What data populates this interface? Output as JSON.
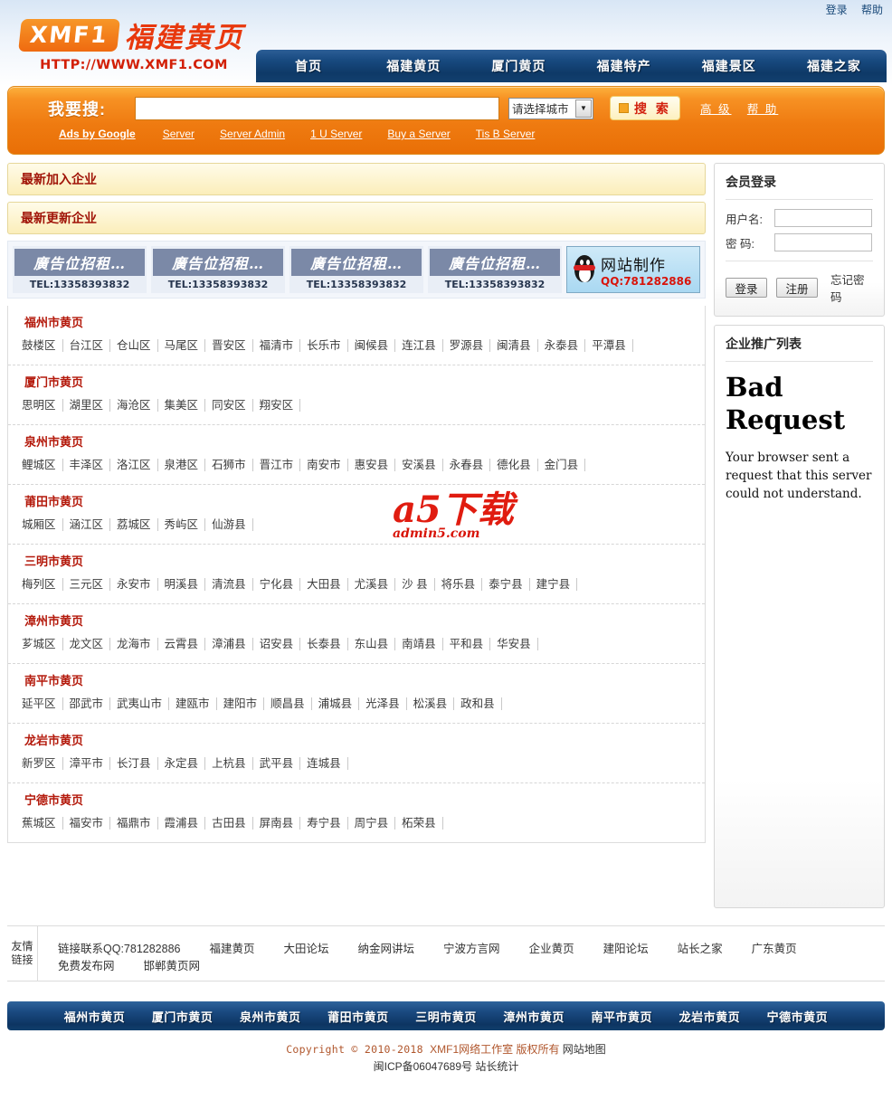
{
  "top": {
    "links": [
      {
        "label": "登录"
      },
      {
        "label": "帮助"
      }
    ]
  },
  "logo": {
    "mark": "XMF1",
    "cn": "福建黄页",
    "url": "HTTP://WWW.XMF1.COM"
  },
  "mainnav": [
    {
      "label": "首页"
    },
    {
      "label": "福建黄页"
    },
    {
      "label": "厦门黄页"
    },
    {
      "label": "福建特产"
    },
    {
      "label": "福建景区"
    },
    {
      "label": "福建之家"
    }
  ],
  "search": {
    "label": "我要搜:",
    "input_value": "",
    "input_placeholder": "",
    "city_selected": "请选择城市",
    "button": "搜 索",
    "advanced": "高 级",
    "help": "帮 助",
    "ads_label": "Ads by Google",
    "ads_links": [
      {
        "label": "Server"
      },
      {
        "label": "Server Admin"
      },
      {
        "label": "1 U Server"
      },
      {
        "label": "Buy a Server"
      },
      {
        "label": "Tis B Server"
      }
    ]
  },
  "panels": {
    "newest_joined": "最新加入企业",
    "newest_updated": "最新更新企业"
  },
  "ads": {
    "banner_text": "廣告位招租…",
    "banner_tel": "TEL:13358393832",
    "banner_count": 4,
    "qq_title": "网站制作",
    "qq_number": "QQ:781282886"
  },
  "watermark": {
    "big": "a5下载",
    "domain": "admin5.com"
  },
  "cities": [
    {
      "title": "福州市黄页",
      "districts": [
        "鼓楼区",
        "台江区",
        "仓山区",
        "马尾区",
        "晋安区",
        "福清市",
        "长乐市",
        "闽候县",
        "连江县",
        "罗源县",
        "闽清县",
        "永泰县",
        "平潭县"
      ]
    },
    {
      "title": "厦门市黄页",
      "districts": [
        "思明区",
        "湖里区",
        "海沧区",
        "集美区",
        "同安区",
        "翔安区"
      ]
    },
    {
      "title": "泉州市黄页",
      "districts": [
        "鲤城区",
        "丰泽区",
        "洛江区",
        "泉港区",
        "石狮市",
        "晋江市",
        "南安市",
        "惠安县",
        "安溪县",
        "永春县",
        "德化县",
        "金门县"
      ]
    },
    {
      "title": "莆田市黄页",
      "districts": [
        "城厢区",
        "涵江区",
        "荔城区",
        "秀屿区",
        "仙游县"
      ]
    },
    {
      "title": "三明市黄页",
      "districts": [
        "梅列区",
        "三元区",
        "永安市",
        "明溪县",
        "清流县",
        "宁化县",
        "大田县",
        "尤溪县",
        "沙  县",
        "将乐县",
        "泰宁县",
        "建宁县"
      ]
    },
    {
      "title": "漳州市黄页",
      "districts": [
        "芗城区",
        "龙文区",
        "龙海市",
        "云霄县",
        "漳浦县",
        "诏安县",
        "长泰县",
        "东山县",
        "南靖县",
        "平和县",
        "华安县"
      ]
    },
    {
      "title": "南平市黄页",
      "districts": [
        "延平区",
        "邵武市",
        "武夷山市",
        "建瓯市",
        "建阳市",
        "顺昌县",
        "浦城县",
        "光泽县",
        "松溪县",
        "政和县"
      ]
    },
    {
      "title": "龙岩市黄页",
      "districts": [
        "新罗区",
        "漳平市",
        "长汀县",
        "永定县",
        "上杭县",
        "武平县",
        "连城县"
      ]
    },
    {
      "title": "宁德市黄页",
      "districts": [
        "蕉城区",
        "福安市",
        "福鼎市",
        "霞浦县",
        "古田县",
        "屏南县",
        "寿宁县",
        "周宁县",
        "柘荣县"
      ]
    }
  ],
  "sidebar": {
    "login_title": "会员登录",
    "username_label": "用户名:",
    "username_value": "",
    "password_label": "密  码:",
    "password_value": "",
    "login_button": "登录",
    "register_button": "注册",
    "forgot": "忘记密码",
    "promo_title": "企业推广列表",
    "promo_error_title": "Bad Request",
    "promo_error_body": "Your browser sent a request that this server could not understand."
  },
  "friend": {
    "label": "友情链接",
    "qq_text": "链接联系QQ:781282886",
    "links": [
      {
        "label": "福建黄页"
      },
      {
        "label": "大田论坛"
      },
      {
        "label": "纳金网讲坛"
      },
      {
        "label": "宁波方言网"
      },
      {
        "label": "企业黄页"
      },
      {
        "label": "建阳论坛"
      },
      {
        "label": "站长之家"
      },
      {
        "label": "广东黄页"
      },
      {
        "label": "免费发布网"
      },
      {
        "label": "邯郸黄页网"
      }
    ]
  },
  "bottomnav": [
    {
      "label": "福州市黄页"
    },
    {
      "label": "厦门市黄页"
    },
    {
      "label": "泉州市黄页"
    },
    {
      "label": "莆田市黄页"
    },
    {
      "label": "三明市黄页"
    },
    {
      "label": "漳州市黄页"
    },
    {
      "label": "南平市黄页"
    },
    {
      "label": "龙岩市黄页"
    },
    {
      "label": "宁德市黄页"
    }
  ],
  "copyright": {
    "line1_en": "Copyright © 2010-2018 ",
    "line1_cn": "XMF1网络工作室 版权所有 ",
    "line1_map": "网站地图",
    "line2": "闽ICP备06047689号 站长统计"
  },
  "colors": {
    "orange": "#ef7b11",
    "navy": "#0e3967",
    "red_title": "#b41a0c",
    "panel_yellow": "#fdf4cf"
  }
}
